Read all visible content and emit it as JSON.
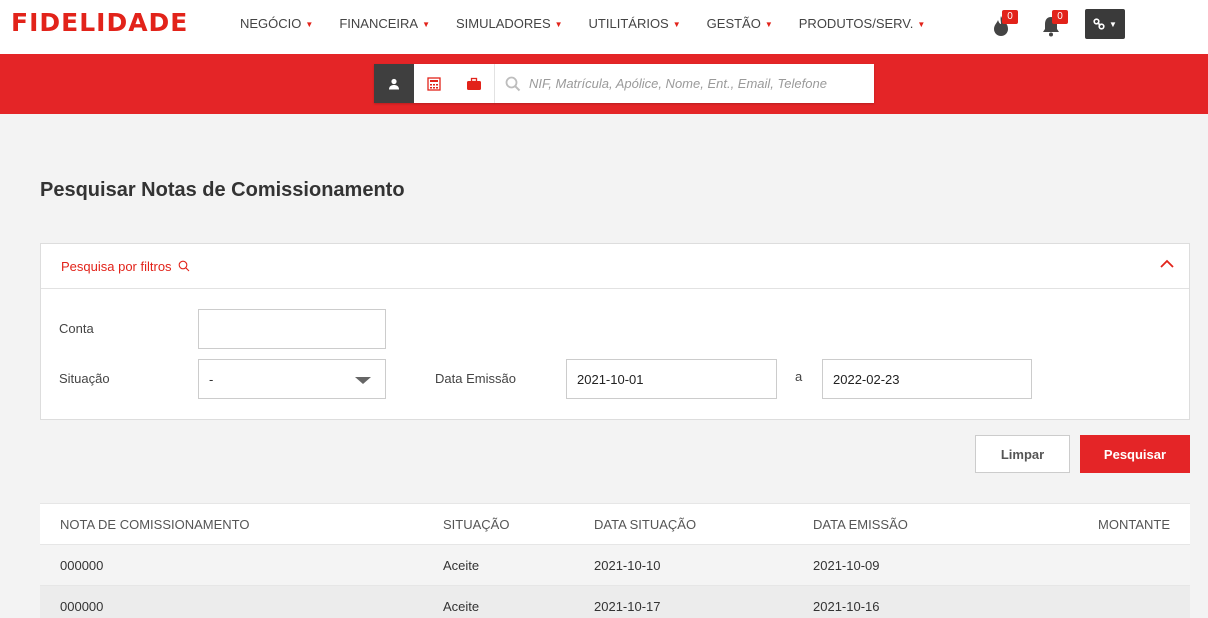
{
  "brand": {
    "logo_text": "FIDELIDADE",
    "accent": "#e2231a"
  },
  "nav": {
    "items": [
      {
        "label": "NEGÓCIO"
      },
      {
        "label": "FINANCEIRA"
      },
      {
        "label": "SIMULADORES"
      },
      {
        "label": "UTILITÁRIOS"
      },
      {
        "label": "GESTÃO"
      },
      {
        "label": "PRODUTOS/SERV."
      }
    ],
    "flame_badge": "0",
    "bell_badge": "0"
  },
  "search": {
    "placeholder": "NIF, Matrícula, Apólice, Nome, Ent., Email, Telefone",
    "tabs": [
      "user-icon",
      "calculator-icon",
      "briefcase-icon"
    ]
  },
  "page": {
    "title": "Pesquisar Notas de Comissionamento"
  },
  "filters": {
    "header": "Pesquisa por filtros",
    "conta_label": "Conta",
    "conta_value": "",
    "situacao_label": "Situação",
    "situacao_value": "-",
    "data_emissao_label": "Data Emissão",
    "date_from": "2021-10-01",
    "date_sep": "a",
    "date_to": "2022-02-23"
  },
  "buttons": {
    "clear": "Limpar",
    "search": "Pesquisar"
  },
  "table": {
    "headers": [
      "NOTA DE COMISSIONAMENTO",
      "SITUAÇÃO",
      "DATA SITUAÇÃO",
      "DATA EMISSÃO",
      "MONTANTE"
    ],
    "rows": [
      [
        "000000",
        "Aceite",
        "2021-10-10",
        "2021-10-09",
        ""
      ],
      [
        "000000",
        "Aceite",
        "2021-10-17",
        "2021-10-16",
        ""
      ]
    ]
  }
}
